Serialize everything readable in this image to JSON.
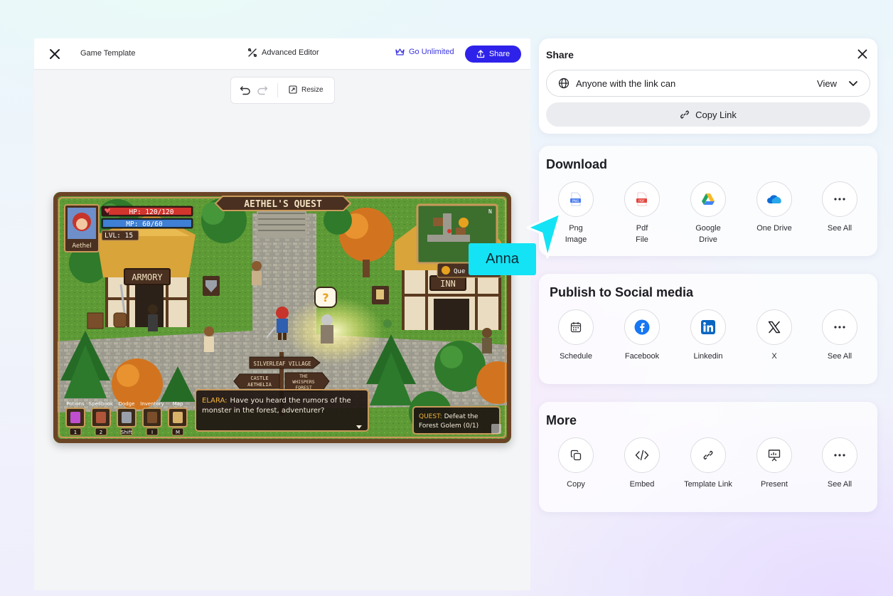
{
  "editor": {
    "title": "Game Template",
    "advanced_editor": "Advanced Editor",
    "go_unlimited": "Go Unlimited",
    "share_label": "Share",
    "resize_label": "Resize"
  },
  "game": {
    "quest_title": "AETHEL'S QUEST",
    "hero_name": "Aethel",
    "hp": "HP: 120/120",
    "hp_fraction": 1.0,
    "mp": "MP:    60/60",
    "mp_fraction": 1.0,
    "level": "LVL: 15",
    "armory_sign": "ARMORY",
    "inn_sign": "INN",
    "minimap_north": "N",
    "minimap_label": "Que",
    "signpost_village": "SILVERLEAF VILLAGE",
    "signpost_castle": "CASTLE\nAETHELIA",
    "signpost_forest": "THE\nWHISPERS\nFOREST",
    "dialogue_speaker": "ELARA:",
    "dialogue_text_1": "Have you heard the rumors of the",
    "dialogue_text_2": "monster in the forest, adventurer?",
    "quest_prefix": "QUEST:",
    "quest_text_1": "Defeat the",
    "quest_text_2": "Forest Golem (0/1)",
    "hotbar": [
      {
        "label": "Potions",
        "key": "1"
      },
      {
        "label": "Spellbook",
        "key": "2"
      },
      {
        "label": "Dodge",
        "key": "Shift"
      },
      {
        "label": "Inventory",
        "key": "I"
      },
      {
        "label": "Map",
        "key": "M"
      }
    ]
  },
  "share_panel": {
    "title": "Share",
    "permission_label": "Anyone with the link can",
    "permission_value": "View",
    "copy_link": "Copy Link"
  },
  "download": {
    "title": "Download",
    "items": [
      {
        "label": "Png\nImage",
        "icon": "png-file-icon"
      },
      {
        "label": "Pdf\nFile",
        "icon": "pdf-file-icon"
      },
      {
        "label": "Google\nDrive",
        "icon": "google-drive-icon"
      },
      {
        "label": "One Drive",
        "icon": "onedrive-icon"
      },
      {
        "label": "See All",
        "icon": "more-icon"
      }
    ]
  },
  "social": {
    "title": "Publish to Social media",
    "items": [
      {
        "label": "Schedule",
        "icon": "calendar-icon"
      },
      {
        "label": "Facebook",
        "icon": "facebook-icon"
      },
      {
        "label": "Linkedin",
        "icon": "linkedin-icon"
      },
      {
        "label": "X",
        "icon": "x-icon"
      },
      {
        "label": "See All",
        "icon": "more-icon"
      }
    ]
  },
  "more": {
    "title": "More",
    "items": [
      {
        "label": "Copy",
        "icon": "copy-icon"
      },
      {
        "label": "Embed",
        "icon": "code-icon"
      },
      {
        "label": "Template Link",
        "icon": "link-icon"
      },
      {
        "label": "Present",
        "icon": "presentation-icon"
      },
      {
        "label": "See All",
        "icon": "more-icon"
      }
    ]
  },
  "collaborator": {
    "name": "Anna",
    "color": "#14e3f5"
  },
  "colors": {
    "accent": "#2e22ea",
    "unlimited": "#3a35e0"
  }
}
